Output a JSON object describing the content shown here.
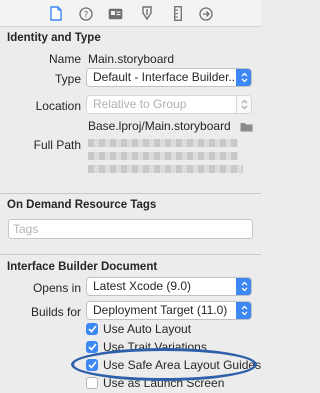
{
  "tabs": [
    {
      "icon": "file-icon",
      "active": true
    },
    {
      "icon": "help-icon",
      "active": false
    },
    {
      "icon": "identity-card-icon",
      "active": false
    },
    {
      "icon": "attributes-icon",
      "active": false
    },
    {
      "icon": "size-ruler-icon",
      "active": false
    },
    {
      "icon": "connections-icon",
      "active": false
    }
  ],
  "identity": {
    "header": "Identity and Type",
    "name_label": "Name",
    "name_value": "Main.storyboard",
    "type_label": "Type",
    "type_value": "Default - Interface Builder...",
    "location_label": "Location",
    "location_value": "Relative to Group",
    "location_path": "Base.lproj/Main.storyboard",
    "fullpath_label": "Full Path"
  },
  "tags": {
    "header": "On Demand Resource Tags",
    "placeholder": "Tags"
  },
  "ib_document": {
    "header": "Interface Builder Document",
    "opens_in_label": "Opens in",
    "opens_in_value": "Latest Xcode (9.0)",
    "builds_for_label": "Builds for",
    "builds_for_value": "Deployment Target (11.0)",
    "checkboxes": [
      {
        "label": "Use Auto Layout",
        "checked": true
      },
      {
        "label": "Use Trait Variations",
        "checked": true
      },
      {
        "label": "Use Safe Area Layout Guides",
        "checked": true
      },
      {
        "label": "Use as Launch Screen",
        "checked": false
      }
    ]
  },
  "colors": {
    "accent": "#3d88f5",
    "highlight": "#2d5faa"
  }
}
